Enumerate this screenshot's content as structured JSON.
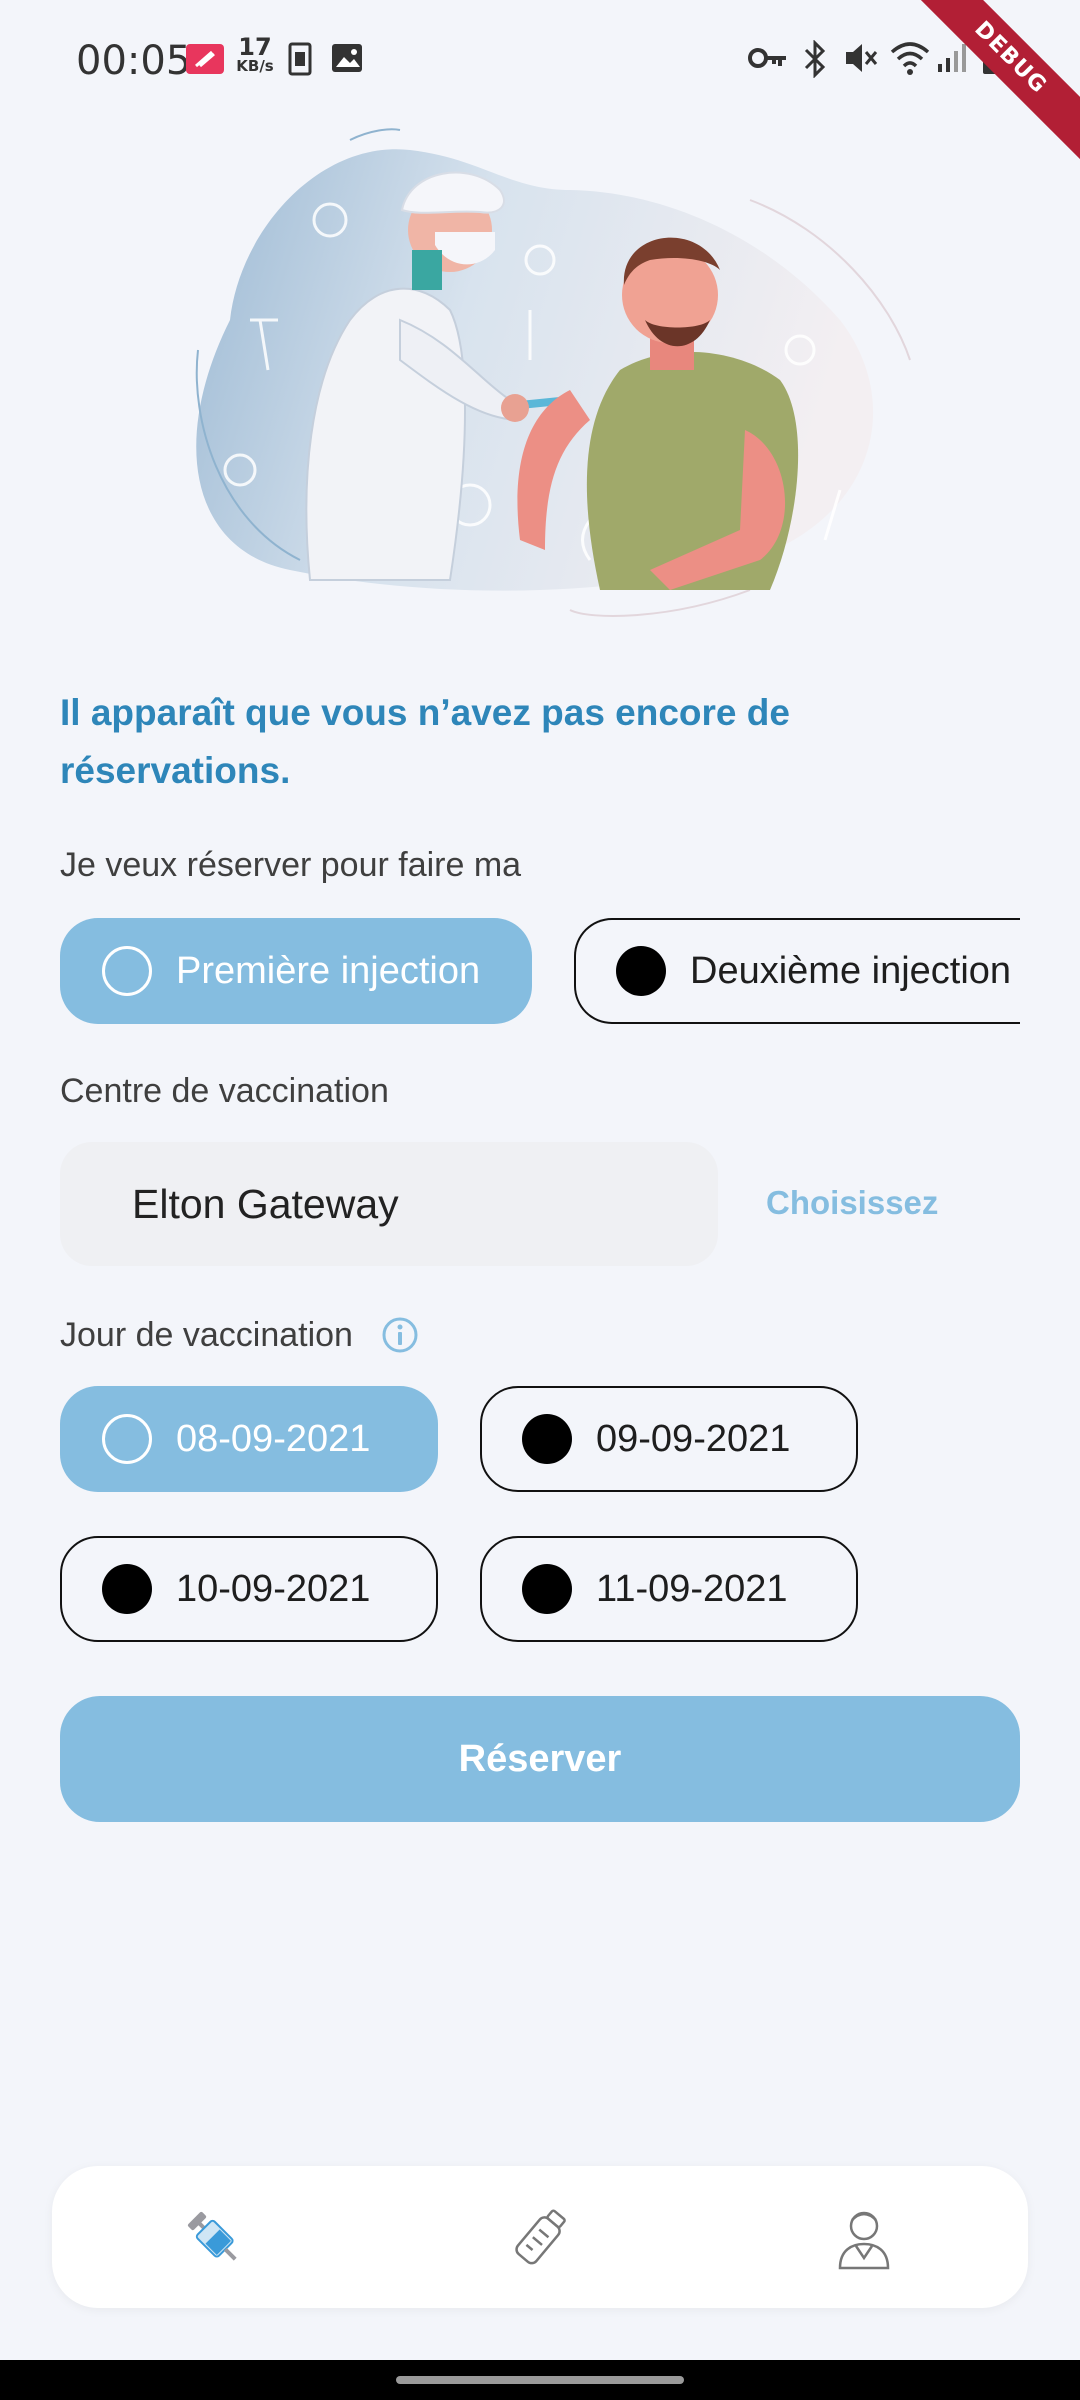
{
  "status_bar": {
    "time": "00:05",
    "net_speed_value": "17",
    "net_speed_unit": "KB/s",
    "icons": [
      "app-notification-icon",
      "sim-icon",
      "gallery-icon",
      "vpn-key-icon",
      "bluetooth-icon",
      "mute-icon",
      "wifi-icon",
      "signal-icon",
      "battery-icon"
    ]
  },
  "debug_banner": "DEBUG",
  "headline": "Il apparaît que vous n’avez pas encore de réservations.",
  "injection": {
    "label": "Je veux réserver pour faire ma",
    "options": [
      {
        "label": "Première injection",
        "selected": true
      },
      {
        "label": "Deuxième injection",
        "selected": false
      }
    ]
  },
  "center": {
    "label": "Centre de vaccination",
    "value": "Elton Gateway",
    "choose_label": "Choisissez"
  },
  "day": {
    "label": "Jour de vaccination",
    "info_icon": "info-icon",
    "options": [
      {
        "label": "08-09-2021",
        "selected": true
      },
      {
        "label": "09-09-2021",
        "selected": false
      },
      {
        "label": "10-09-2021",
        "selected": false
      },
      {
        "label": "11-09-2021",
        "selected": false
      }
    ]
  },
  "book_button": "Réserver",
  "bottom_nav": {
    "items": [
      {
        "icon": "syringe-icon",
        "active": true
      },
      {
        "icon": "vaccine-vial-icon",
        "active": false
      },
      {
        "icon": "doctor-profile-icon",
        "active": false
      }
    ]
  },
  "colors": {
    "accent": "#85bde0",
    "headline": "#2e86b9",
    "background": "#f3f5fa",
    "debug": "#b21f35"
  }
}
